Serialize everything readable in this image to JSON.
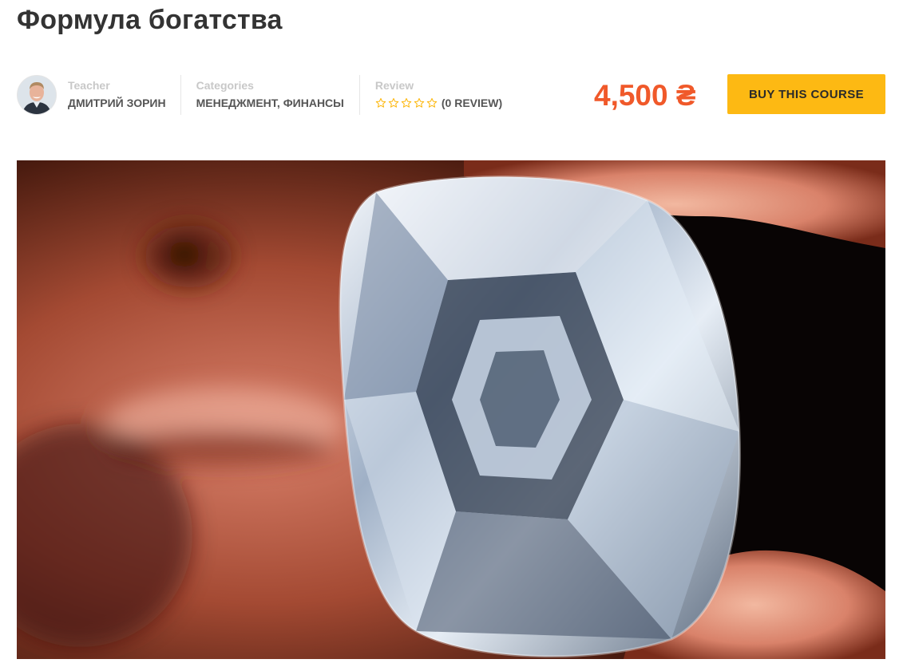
{
  "course": {
    "title": "Формула богатства",
    "teacher": {
      "label": "Teacher",
      "name": "ДМИТРИЙ ЗОРИН"
    },
    "categories": {
      "label": "Categories",
      "value": "МЕНЕДЖМЕНТ, ФИНАНСЫ"
    },
    "review": {
      "label": "Review",
      "rating": 0,
      "max_stars": 5,
      "count_text": "(0 REVIEW)"
    },
    "price": "4,500 ₴",
    "buy_label": "BUY THIS COURSE"
  },
  "colors": {
    "price": "#f0592a",
    "button": "#fdb913",
    "star_outline": "#fdb913",
    "label_gray": "#c8c8c8",
    "title": "#333333"
  },
  "icons": {
    "avatar": "teacher-avatar-photo",
    "star": "star-outline-icon",
    "hero": "diamond-hero-photo"
  }
}
